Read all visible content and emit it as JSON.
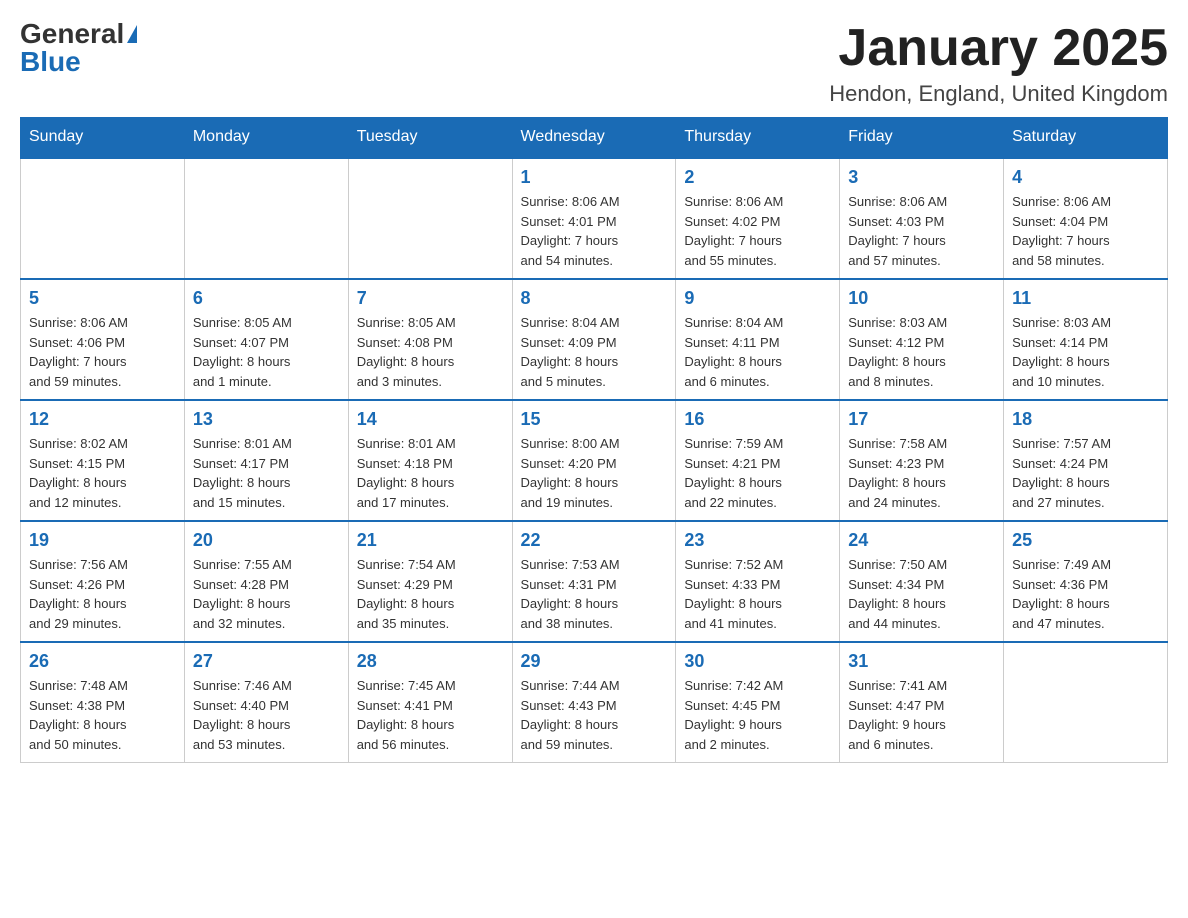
{
  "header": {
    "title": "January 2025",
    "subtitle": "Hendon, England, United Kingdom",
    "logo_general": "General",
    "logo_blue": "Blue"
  },
  "days_of_week": [
    "Sunday",
    "Monday",
    "Tuesday",
    "Wednesday",
    "Thursday",
    "Friday",
    "Saturday"
  ],
  "weeks": [
    [
      {
        "day": "",
        "info": ""
      },
      {
        "day": "",
        "info": ""
      },
      {
        "day": "",
        "info": ""
      },
      {
        "day": "1",
        "info": "Sunrise: 8:06 AM\nSunset: 4:01 PM\nDaylight: 7 hours\nand 54 minutes."
      },
      {
        "day": "2",
        "info": "Sunrise: 8:06 AM\nSunset: 4:02 PM\nDaylight: 7 hours\nand 55 minutes."
      },
      {
        "day": "3",
        "info": "Sunrise: 8:06 AM\nSunset: 4:03 PM\nDaylight: 7 hours\nand 57 minutes."
      },
      {
        "day": "4",
        "info": "Sunrise: 8:06 AM\nSunset: 4:04 PM\nDaylight: 7 hours\nand 58 minutes."
      }
    ],
    [
      {
        "day": "5",
        "info": "Sunrise: 8:06 AM\nSunset: 4:06 PM\nDaylight: 7 hours\nand 59 minutes."
      },
      {
        "day": "6",
        "info": "Sunrise: 8:05 AM\nSunset: 4:07 PM\nDaylight: 8 hours\nand 1 minute."
      },
      {
        "day": "7",
        "info": "Sunrise: 8:05 AM\nSunset: 4:08 PM\nDaylight: 8 hours\nand 3 minutes."
      },
      {
        "day": "8",
        "info": "Sunrise: 8:04 AM\nSunset: 4:09 PM\nDaylight: 8 hours\nand 5 minutes."
      },
      {
        "day": "9",
        "info": "Sunrise: 8:04 AM\nSunset: 4:11 PM\nDaylight: 8 hours\nand 6 minutes."
      },
      {
        "day": "10",
        "info": "Sunrise: 8:03 AM\nSunset: 4:12 PM\nDaylight: 8 hours\nand 8 minutes."
      },
      {
        "day": "11",
        "info": "Sunrise: 8:03 AM\nSunset: 4:14 PM\nDaylight: 8 hours\nand 10 minutes."
      }
    ],
    [
      {
        "day": "12",
        "info": "Sunrise: 8:02 AM\nSunset: 4:15 PM\nDaylight: 8 hours\nand 12 minutes."
      },
      {
        "day": "13",
        "info": "Sunrise: 8:01 AM\nSunset: 4:17 PM\nDaylight: 8 hours\nand 15 minutes."
      },
      {
        "day": "14",
        "info": "Sunrise: 8:01 AM\nSunset: 4:18 PM\nDaylight: 8 hours\nand 17 minutes."
      },
      {
        "day": "15",
        "info": "Sunrise: 8:00 AM\nSunset: 4:20 PM\nDaylight: 8 hours\nand 19 minutes."
      },
      {
        "day": "16",
        "info": "Sunrise: 7:59 AM\nSunset: 4:21 PM\nDaylight: 8 hours\nand 22 minutes."
      },
      {
        "day": "17",
        "info": "Sunrise: 7:58 AM\nSunset: 4:23 PM\nDaylight: 8 hours\nand 24 minutes."
      },
      {
        "day": "18",
        "info": "Sunrise: 7:57 AM\nSunset: 4:24 PM\nDaylight: 8 hours\nand 27 minutes."
      }
    ],
    [
      {
        "day": "19",
        "info": "Sunrise: 7:56 AM\nSunset: 4:26 PM\nDaylight: 8 hours\nand 29 minutes."
      },
      {
        "day": "20",
        "info": "Sunrise: 7:55 AM\nSunset: 4:28 PM\nDaylight: 8 hours\nand 32 minutes."
      },
      {
        "day": "21",
        "info": "Sunrise: 7:54 AM\nSunset: 4:29 PM\nDaylight: 8 hours\nand 35 minutes."
      },
      {
        "day": "22",
        "info": "Sunrise: 7:53 AM\nSunset: 4:31 PM\nDaylight: 8 hours\nand 38 minutes."
      },
      {
        "day": "23",
        "info": "Sunrise: 7:52 AM\nSunset: 4:33 PM\nDaylight: 8 hours\nand 41 minutes."
      },
      {
        "day": "24",
        "info": "Sunrise: 7:50 AM\nSunset: 4:34 PM\nDaylight: 8 hours\nand 44 minutes."
      },
      {
        "day": "25",
        "info": "Sunrise: 7:49 AM\nSunset: 4:36 PM\nDaylight: 8 hours\nand 47 minutes."
      }
    ],
    [
      {
        "day": "26",
        "info": "Sunrise: 7:48 AM\nSunset: 4:38 PM\nDaylight: 8 hours\nand 50 minutes."
      },
      {
        "day": "27",
        "info": "Sunrise: 7:46 AM\nSunset: 4:40 PM\nDaylight: 8 hours\nand 53 minutes."
      },
      {
        "day": "28",
        "info": "Sunrise: 7:45 AM\nSunset: 4:41 PM\nDaylight: 8 hours\nand 56 minutes."
      },
      {
        "day": "29",
        "info": "Sunrise: 7:44 AM\nSunset: 4:43 PM\nDaylight: 8 hours\nand 59 minutes."
      },
      {
        "day": "30",
        "info": "Sunrise: 7:42 AM\nSunset: 4:45 PM\nDaylight: 9 hours\nand 2 minutes."
      },
      {
        "day": "31",
        "info": "Sunrise: 7:41 AM\nSunset: 4:47 PM\nDaylight: 9 hours\nand 6 minutes."
      },
      {
        "day": "",
        "info": ""
      }
    ]
  ]
}
